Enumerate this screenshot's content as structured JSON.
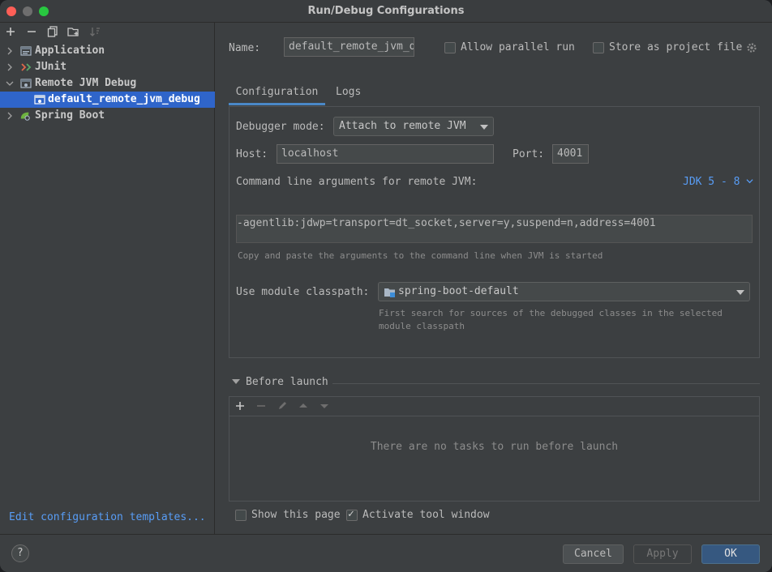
{
  "window": {
    "title": "Run/Debug Configurations"
  },
  "left": {
    "toolbar_icons": [
      "plus-icon",
      "minus-icon",
      "copy-icon",
      "folder-plus-icon",
      "sort-icon"
    ],
    "tree": [
      {
        "label": "Application",
        "expanded": false,
        "icon": "application-icon"
      },
      {
        "label": "JUnit",
        "expanded": false,
        "icon": "junit-icon"
      },
      {
        "label": "Remote JVM Debug",
        "expanded": true,
        "icon": "remote-debug-icon"
      },
      {
        "label": "default_remote_jvm_debug",
        "selected": true,
        "icon": "remote-debug-icon"
      },
      {
        "label": "Spring Boot",
        "expanded": false,
        "icon": "spring-boot-icon"
      }
    ],
    "edit_templates": "Edit configuration templates..."
  },
  "right": {
    "name_label": "Name:",
    "name_value": "default_remote_jvm_debug",
    "allow_parallel": "Allow parallel run",
    "store_as_project": "Store as project file",
    "tabs": [
      "Configuration",
      "Logs"
    ],
    "debugger_mode_label": "Debugger mode:",
    "debugger_mode_value": "Attach to remote JVM",
    "host_label": "Host:",
    "host_value": "localhost",
    "port_label": "Port:",
    "port_value": "4001",
    "cmdline_label": "Command line arguments for remote JVM:",
    "jdk_selector": "JDK 5 - 8",
    "cmdline_value": "-agentlib:jdwp=transport=dt_socket,server=y,suspend=n,address=4001",
    "cmdline_hint": "Copy and paste the arguments to the command line when JVM is started",
    "module_label": "Use module classpath:",
    "module_value": "spring-boot-default",
    "module_hint_1": "First search for sources of the debugged classes in the selected",
    "module_hint_2": "module classpath",
    "before_launch": "Before launch",
    "no_tasks": "There are no tasks to run before launch",
    "show_page": "Show this page",
    "activate_tool": "Activate tool window"
  },
  "footer": {
    "help": "?",
    "cancel": "Cancel",
    "apply": "Apply",
    "ok": "OK"
  }
}
